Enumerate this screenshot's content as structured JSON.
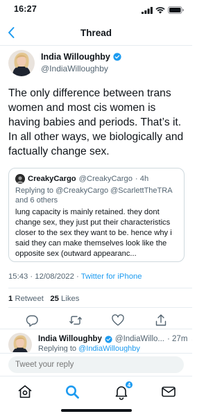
{
  "status_bar": {
    "time": "16:27"
  },
  "nav": {
    "title": "Thread"
  },
  "tweet": {
    "author_name": "India Willoughby",
    "author_handle": "@IndiaWilloughby",
    "text": "The only difference between trans women and most cis women is having babies and periods. That’s it. In all other ways, we biologically and factually change sex.",
    "timestamp": "15:43 · 12/08/2022 · ",
    "source": "Twitter for iPhone",
    "retweet_count": "1",
    "retweet_label": "Retweet",
    "like_count": "25",
    "like_label": "Likes"
  },
  "quote": {
    "author_name": "CreakyCargo",
    "author_handle": "@CreakyCargo",
    "age": "· 4h",
    "replying_prefix": "Replying to ",
    "replying_users": "@CreakyCargo @ScarlettTheTRA",
    "replying_suffix": " and 6 others",
    "text": "lung capacity is mainly retained. they dont change sex, they just put their characteristics closer to the sex they want to be. hence why i said they can make themselves look like the opposite sex (outward appearanc..."
  },
  "reply": {
    "author_name": "India Willoughby",
    "author_handle": "@IndiaWillo...",
    "age": "· 27m",
    "replying_prefix": "Replying to ",
    "replying_user": "@IndiaWilloughby"
  },
  "composer": {
    "placeholder": "Tweet your reply"
  },
  "tab_bar": {
    "notifications_badge": "4"
  },
  "colors": {
    "accent": "#1d9bf0",
    "text": "#0f1419",
    "secondary": "#536471"
  }
}
